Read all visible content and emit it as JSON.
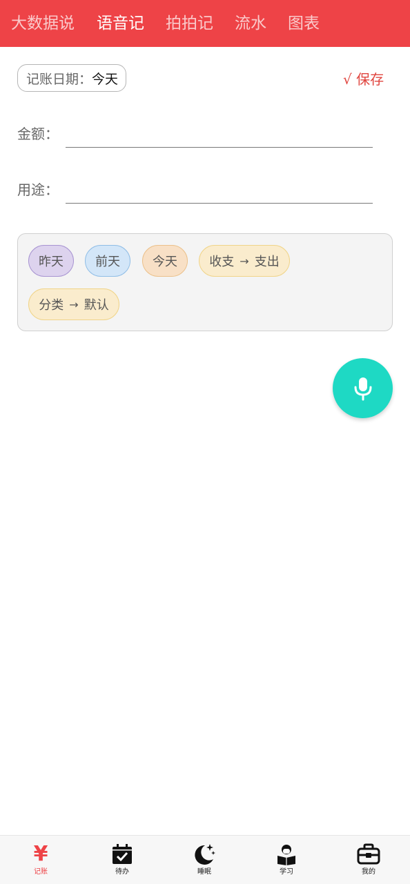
{
  "tabs": [
    {
      "label": "大数据说",
      "active": false
    },
    {
      "label": "语音记",
      "active": true
    },
    {
      "label": "拍拍记",
      "active": false
    },
    {
      "label": "流水",
      "active": false
    },
    {
      "label": "图表",
      "active": false
    }
  ],
  "form": {
    "date_label": "记账日期：",
    "date_value": "今天",
    "save_label": "√ 保存",
    "amount_label": "金额：",
    "amount_value": "",
    "purpose_label": "用途：",
    "purpose_value": ""
  },
  "chips": {
    "yesterday": "昨天",
    "day_before": "前天",
    "today": "今天",
    "type_key": "收支",
    "type_value": "支出",
    "category_key": "分类",
    "category_value": "默认",
    "arrow": "→"
  },
  "bottom_nav": [
    {
      "label": "记账",
      "icon": "yen-icon",
      "active": true,
      "glyph": "¥"
    },
    {
      "label": "待办",
      "icon": "calendar-check-icon",
      "active": false
    },
    {
      "label": "睡眠",
      "icon": "moon-stars-icon",
      "active": false
    },
    {
      "label": "学习",
      "icon": "student-reading-icon",
      "active": false
    },
    {
      "label": "我的",
      "icon": "toolbox-icon",
      "active": false
    }
  ],
  "colors": {
    "brand_red": "#ee4347",
    "fab_teal": "#1ed9c4",
    "save_red": "#e0453f"
  }
}
